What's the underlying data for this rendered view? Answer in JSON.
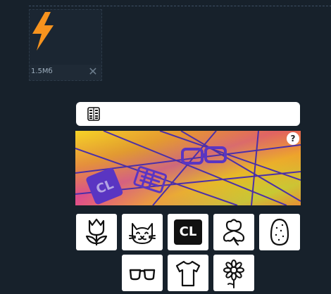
{
  "file": {
    "size": "1.5Мб",
    "thumb_icon": "lightning-bolt-icon",
    "remove_icon": "close-icon"
  },
  "captcha": {
    "instruction_icon": "abacus-icon",
    "help_label": "?",
    "options": [
      {
        "name": "tulip"
      },
      {
        "name": "cat"
      },
      {
        "name": "cl-badge",
        "label": "CL"
      },
      {
        "name": "clover"
      },
      {
        "name": "egg"
      },
      {
        "name": "glasses"
      },
      {
        "name": "t-shirt"
      },
      {
        "name": "sunflower"
      }
    ]
  },
  "colors": {
    "background": "#17212b",
    "bolt": "#f7931e",
    "captcha_lines": "#4b2fa8"
  }
}
